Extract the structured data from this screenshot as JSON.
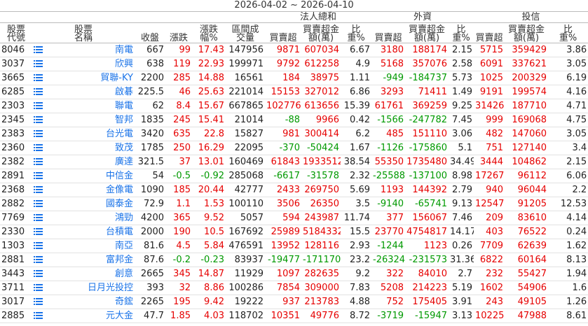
{
  "date_range": "2026-04-02 ~ 2026-04-10",
  "groups": {
    "institutional": "法人總和",
    "foreign": "外資",
    "trust": "投信"
  },
  "headers": {
    "code": "股票代號",
    "name": "股票名稱",
    "close": "收盤",
    "change": "漲跌",
    "change_pct": "漲跌幅%",
    "volume": "區間成交量",
    "inst_net": "買賣超",
    "inst_amt": "買賣超金額(萬)",
    "inst_ratio": "比重%",
    "for_net": "買賣超",
    "for_amt": "買賣超金額(萬)",
    "for_ratio": "比重%",
    "trust_net": "買賣超",
    "trust_amt": "買賣超金額(萬)",
    "trust_ratio": "比重%"
  },
  "rows": [
    {
      "code": "8046",
      "name": "南電",
      "close": "667",
      "change": "99",
      "pct": "17.43",
      "volume": "147956",
      "i_net": "9871",
      "i_amt": "607034",
      "i_ratio": "6.67",
      "f_net": "3180",
      "f_amt": "188174",
      "f_ratio": "2.15",
      "t_net": "5715",
      "t_amt": "359429",
      "t_ratio": "3.86"
    },
    {
      "code": "3037",
      "name": "欣興",
      "close": "638",
      "change": "119",
      "pct": "22.93",
      "volume": "199971",
      "i_net": "9792",
      "i_amt": "612258",
      "i_ratio": "4.9",
      "f_net": "5168",
      "f_amt": "357076",
      "f_ratio": "2.58",
      "t_net": "6091",
      "t_amt": "337621",
      "t_ratio": "3.05"
    },
    {
      "code": "3665",
      "name": "貿聯-KY",
      "close": "2200",
      "change": "285",
      "pct": "14.88",
      "volume": "16561",
      "i_net": "184",
      "i_amt": "38975",
      "i_ratio": "1.11",
      "f_net": "-949",
      "f_amt": "-184737",
      "f_ratio": "5.73",
      "t_net": "1025",
      "t_amt": "200329",
      "t_ratio": "6.19"
    },
    {
      "code": "6285",
      "name": "啟碁",
      "close": "225.5",
      "change": "46",
      "pct": "25.63",
      "volume": "221014",
      "i_net": "15153",
      "i_amt": "327012",
      "i_ratio": "6.86",
      "f_net": "3293",
      "f_amt": "71411",
      "f_ratio": "1.49",
      "t_net": "9191",
      "t_amt": "199574",
      "t_ratio": "4.16"
    },
    {
      "code": "2303",
      "name": "聯電",
      "close": "62",
      "change": "8.4",
      "pct": "15.67",
      "volume": "667865",
      "i_net": "102776",
      "i_amt": "613656",
      "i_ratio": "15.39",
      "f_net": "61761",
      "f_amt": "369259",
      "f_ratio": "9.25",
      "t_net": "31426",
      "t_amt": "187710",
      "t_ratio": "4.71"
    },
    {
      "code": "2345",
      "name": "智邦",
      "close": "1835",
      "change": "245",
      "pct": "15.41",
      "volume": "21014",
      "i_net": "-88",
      "i_amt": "9966",
      "i_ratio": "0.42",
      "f_net": "-1566",
      "f_amt": "-247782",
      "f_ratio": "7.45",
      "t_net": "999",
      "t_amt": "169068",
      "t_ratio": "4.75"
    },
    {
      "code": "2383",
      "name": "台光電",
      "close": "3420",
      "change": "635",
      "pct": "22.8",
      "volume": "15827",
      "i_net": "981",
      "i_amt": "300414",
      "i_ratio": "6.2",
      "f_net": "485",
      "f_amt": "151110",
      "f_ratio": "3.06",
      "t_net": "482",
      "t_amt": "147060",
      "t_ratio": "3.05"
    },
    {
      "code": "2360",
      "name": "致茂",
      "close": "1785",
      "change": "250",
      "pct": "16.29",
      "volume": "22095",
      "i_net": "-370",
      "i_amt": "-50424",
      "i_ratio": "1.67",
      "f_net": "-1126",
      "f_amt": "-175860",
      "f_ratio": "5.1",
      "t_net": "751",
      "t_amt": "127140",
      "t_ratio": "3.4"
    },
    {
      "code": "2382",
      "name": "廣達",
      "close": "321.5",
      "change": "37",
      "pct": "13.01",
      "volume": "160469",
      "i_net": "61843",
      "i_amt": "1933512",
      "i_ratio": "38.54",
      "f_net": "55350",
      "f_amt": "1735480",
      "f_ratio": "34.49",
      "t_net": "3444",
      "t_amt": "104862",
      "t_ratio": "2.15"
    },
    {
      "code": "2891",
      "name": "中信金",
      "close": "54",
      "change": "-0.5",
      "pct": "-0.92",
      "volume": "285068",
      "i_net": "-6617",
      "i_amt": "-31578",
      "i_ratio": "2.32",
      "f_net": "-25588",
      "f_amt": "-137100",
      "f_ratio": "8.98",
      "t_net": "17267",
      "t_amt": "96112",
      "t_ratio": "6.06"
    },
    {
      "code": "2368",
      "name": "金像電",
      "close": "1090",
      "change": "185",
      "pct": "20.44",
      "volume": "42777",
      "i_net": "2433",
      "i_amt": "269750",
      "i_ratio": "5.69",
      "f_net": "1193",
      "f_amt": "144392",
      "f_ratio": "2.79",
      "t_net": "940",
      "t_amt": "96044",
      "t_ratio": "2.2"
    },
    {
      "code": "2882",
      "name": "國泰金",
      "close": "72.9",
      "change": "1.1",
      "pct": "1.53",
      "volume": "100110",
      "i_net": "3506",
      "i_amt": "26350",
      "i_ratio": "3.5",
      "f_net": "-9140",
      "f_amt": "-65741",
      "f_ratio": "9.13",
      "t_net": "12547",
      "t_amt": "91205",
      "t_ratio": "12.53"
    },
    {
      "code": "7769",
      "name": "鴻勁",
      "close": "4200",
      "change": "365",
      "pct": "9.52",
      "volume": "5057",
      "i_net": "594",
      "i_amt": "243987",
      "i_ratio": "11.74",
      "f_net": "377",
      "f_amt": "156067",
      "f_ratio": "7.46",
      "t_net": "209",
      "t_amt": "83610",
      "t_ratio": "4.14"
    },
    {
      "code": "2330",
      "name": "台積電",
      "close": "2000",
      "change": "190",
      "pct": "10.5",
      "volume": "167692",
      "i_net": "25989",
      "i_amt": "5184332",
      "i_ratio": "15.5",
      "f_net": "23770",
      "f_amt": "4754817",
      "f_ratio": "14.17",
      "t_net": "403",
      "t_amt": "76522",
      "t_ratio": "0.24"
    },
    {
      "code": "1303",
      "name": "南亞",
      "close": "81.6",
      "change": "4.5",
      "pct": "5.84",
      "volume": "476591",
      "i_net": "13952",
      "i_amt": "128116",
      "i_ratio": "2.93",
      "f_net": "-1244",
      "f_amt": "1123",
      "f_ratio": "0.26",
      "t_net": "7709",
      "t_amt": "62639",
      "t_ratio": "1.62"
    },
    {
      "code": "2881",
      "name": "富邦金",
      "close": "87.6",
      "change": "-0.2",
      "pct": "-0.23",
      "volume": "83937",
      "i_net": "-19477",
      "i_amt": "-171170",
      "i_ratio": "23.2",
      "f_net": "-26324",
      "f_amt": "-231573",
      "f_ratio": "31.36",
      "t_net": "6822",
      "t_amt": "60164",
      "t_ratio": "8.13"
    },
    {
      "code": "3443",
      "name": "創意",
      "close": "2665",
      "change": "345",
      "pct": "14.87",
      "volume": "11929",
      "i_net": "1097",
      "i_amt": "282635",
      "i_ratio": "9.2",
      "f_net": "322",
      "f_amt": "84010",
      "f_ratio": "2.7",
      "t_net": "232",
      "t_amt": "55427",
      "t_ratio": "1.94"
    },
    {
      "code": "3711",
      "name": "日月光投控",
      "close": "393",
      "change": "32",
      "pct": "8.86",
      "volume": "100286",
      "i_net": "7854",
      "i_amt": "309000",
      "i_ratio": "7.83",
      "f_net": "5208",
      "f_amt": "214223",
      "f_ratio": "5.19",
      "t_net": "1602",
      "t_amt": "54906",
      "t_ratio": "1.6"
    },
    {
      "code": "3017",
      "name": "奇鋐",
      "close": "2265",
      "change": "195",
      "pct": "9.42",
      "volume": "19222",
      "i_net": "937",
      "i_amt": "213783",
      "i_ratio": "4.88",
      "f_net": "752",
      "f_amt": "175405",
      "f_ratio": "3.91",
      "t_net": "243",
      "t_amt": "49105",
      "t_ratio": "1.26"
    },
    {
      "code": "2885",
      "name": "元大金",
      "close": "47.7",
      "change": "1.85",
      "pct": "4.03",
      "volume": "118702",
      "i_net": "10351",
      "i_amt": "49776",
      "i_ratio": "8.72",
      "f_net": "-3719",
      "f_amt": "-15947",
      "f_ratio": "3.13",
      "t_net": "10225",
      "t_amt": "47988",
      "t_ratio": "8.61"
    }
  ]
}
